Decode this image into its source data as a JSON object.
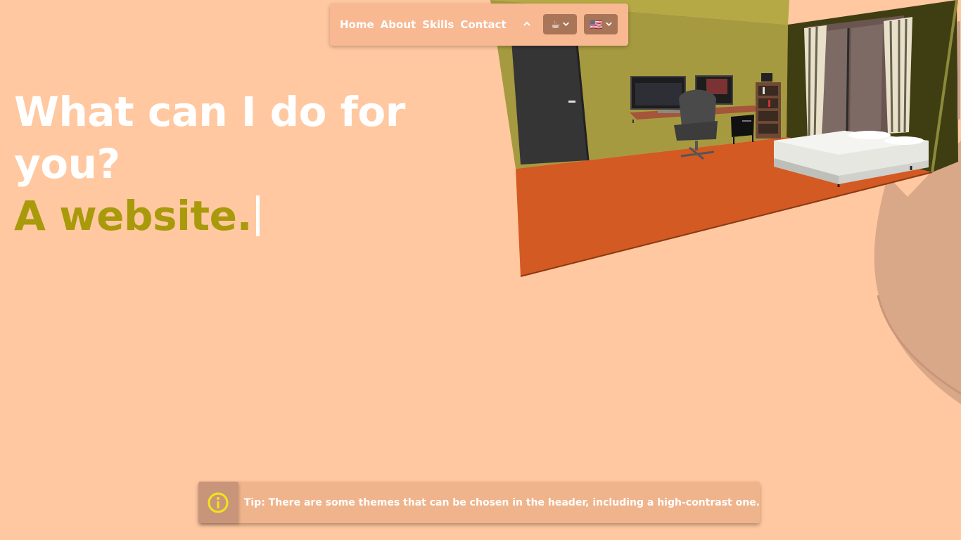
{
  "nav": {
    "links": [
      "Home",
      "About",
      "Skills",
      "Contact"
    ],
    "theme_select_icon": "☕",
    "language_select_icon": "🇺🇸"
  },
  "hero": {
    "question": "What can I do for you?",
    "answer": "A website."
  },
  "tip": {
    "text": "Tip: There are some themes that can be chosen in the header, including a high-contrast one."
  },
  "icons": {
    "collapse": "chevron-up-icon",
    "dropdown": "chevron-down-icon",
    "info": "info-circle-icon"
  },
  "colors": {
    "background": "#ffc8a0",
    "navbar": "#f8b892",
    "accent_text": "#a89a0a",
    "select_bg": "#a97558",
    "tip_bg": "#f0b48c",
    "tip_icon": "#f0e51a"
  }
}
